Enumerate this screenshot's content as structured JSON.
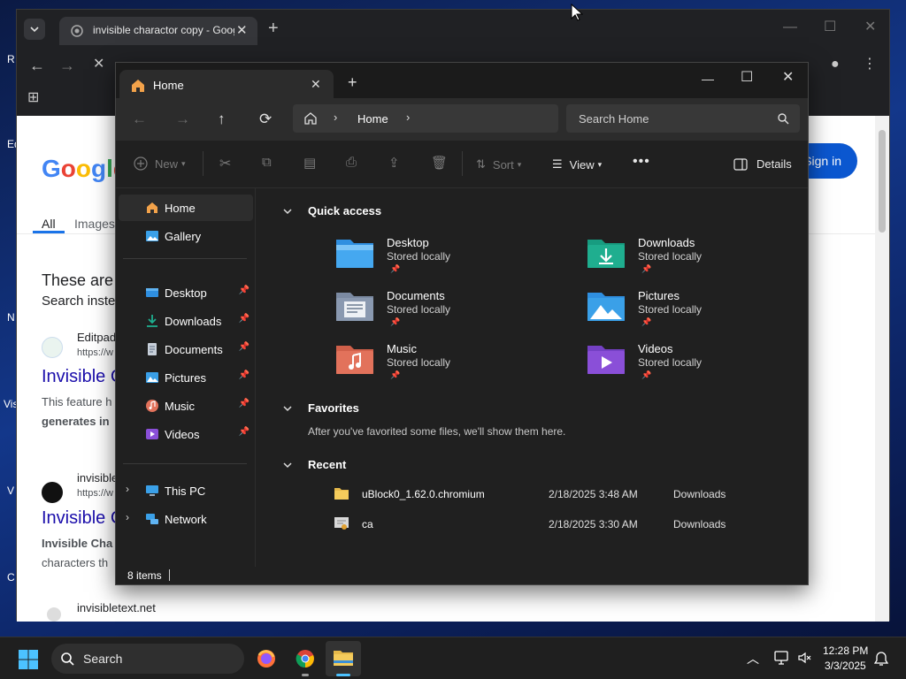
{
  "desktop": {
    "edge_labels": [
      "R",
      "Ed",
      "N",
      "Vis",
      "V",
      "C"
    ]
  },
  "chrome": {
    "tab_title": "invisible charactor copy - Goog",
    "page": {
      "logo": "Google",
      "tabs": [
        "All",
        "Images"
      ],
      "sign_in": "Sign in",
      "heading": "These are",
      "subheading": "Search inste",
      "results": [
        {
          "site": "Editpad",
          "url": "https://w",
          "title": "Invisible C",
          "snippet1": "This feature h",
          "snippet2": "generates in"
        },
        {
          "site": "invisible",
          "url": "https://w",
          "title": "Invisible C",
          "snippet1": "Invisible Cha",
          "snippet2": "characters th"
        },
        {
          "site": "invisibletext.net",
          "url": "",
          "title": "",
          "snippet1": "",
          "snippet2": ""
        }
      ]
    }
  },
  "explorer": {
    "tab_title": "Home",
    "breadcrumb": "Home",
    "search_placeholder": "Search Home",
    "toolbar": {
      "new": "New",
      "sort": "Sort",
      "view": "View",
      "details": "Details"
    },
    "sidebar": {
      "top": [
        {
          "label": "Home",
          "icon": "home-icon",
          "selected": true
        },
        {
          "label": "Gallery",
          "icon": "gallery-icon",
          "selected": false
        }
      ],
      "pinned": [
        {
          "label": "Desktop",
          "icon": "desktop-folder-icon"
        },
        {
          "label": "Downloads",
          "icon": "downloads-folder-icon"
        },
        {
          "label": "Documents",
          "icon": "documents-folder-icon"
        },
        {
          "label": "Pictures",
          "icon": "pictures-folder-icon"
        },
        {
          "label": "Music",
          "icon": "music-folder-icon"
        },
        {
          "label": "Videos",
          "icon": "videos-folder-icon"
        }
      ],
      "devices": [
        {
          "label": "This PC",
          "icon": "this-pc-icon"
        },
        {
          "label": "Network",
          "icon": "network-icon"
        }
      ]
    },
    "quick_access": {
      "title": "Quick access",
      "items": [
        {
          "name": "Desktop",
          "status": "Stored locally",
          "icon": "desktop-folder-icon"
        },
        {
          "name": "Downloads",
          "status": "Stored locally",
          "icon": "downloads-folder-icon"
        },
        {
          "name": "Documents",
          "status": "Stored locally",
          "icon": "documents-folder-icon"
        },
        {
          "name": "Pictures",
          "status": "Stored locally",
          "icon": "pictures-folder-icon"
        },
        {
          "name": "Music",
          "status": "Stored locally",
          "icon": "music-folder-icon"
        },
        {
          "name": "Videos",
          "status": "Stored locally",
          "icon": "videos-folder-icon"
        }
      ]
    },
    "favorites": {
      "title": "Favorites",
      "empty_message": "After you've favorited some files, we'll show them here."
    },
    "recent": {
      "title": "Recent",
      "items": [
        {
          "name": "uBlock0_1.62.0.chromium",
          "date": "2/18/2025 3:48 AM",
          "location": "Downloads",
          "icon": "folder-icon"
        },
        {
          "name": "ca",
          "date": "2/18/2025 3:30 AM",
          "location": "Downloads",
          "icon": "certificate-icon"
        }
      ]
    },
    "status": "8 items"
  },
  "taskbar": {
    "search_label": "Search",
    "time": "12:28 PM",
    "date": "3/3/2025"
  },
  "colors": {
    "folder_blue": "#2f8fe0",
    "folder_teal": "#1fae8f",
    "folder_gray": "#8a99b0",
    "folder_pictures": "#3aa0e8",
    "folder_music": "#e2725b",
    "folder_videos": "#8a4fd8",
    "google_blue": "#1a0dab",
    "signin_blue": "#0b57d0"
  }
}
